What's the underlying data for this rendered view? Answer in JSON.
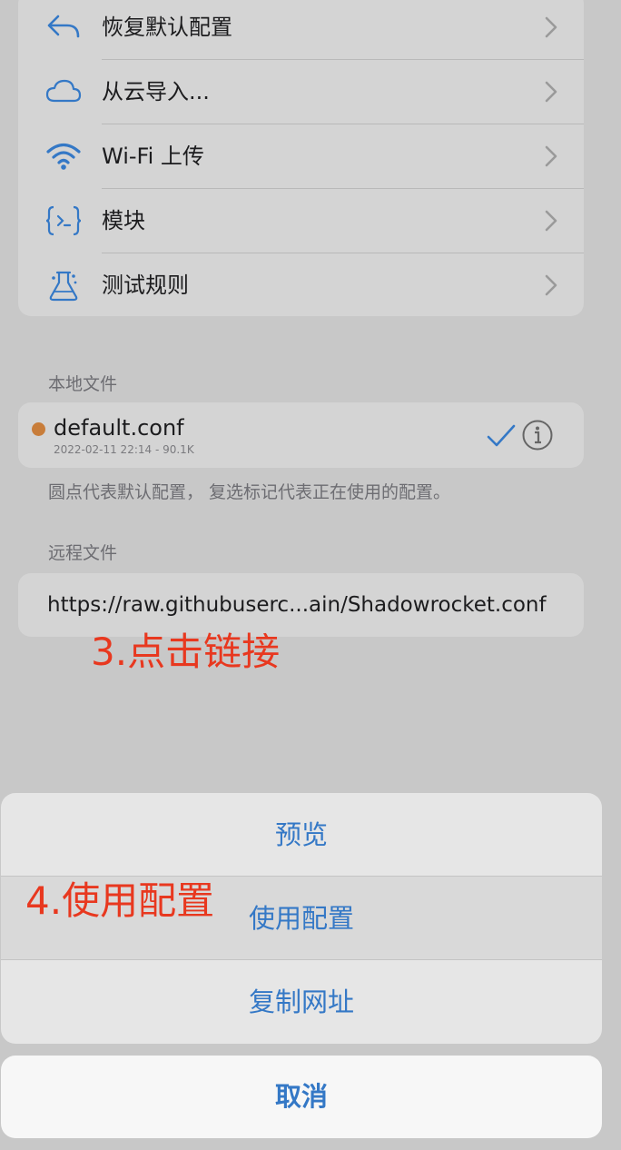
{
  "menu": {
    "items": [
      {
        "label": "恢复默认配置",
        "icon": "undo-arrow-icon"
      },
      {
        "label": "从云导入...",
        "icon": "cloud-icon"
      },
      {
        "label": "Wi-Fi 上传",
        "icon": "wifi-icon"
      },
      {
        "label": "模块",
        "icon": "code-braces-icon"
      },
      {
        "label": "测试规则",
        "icon": "flask-icon"
      }
    ]
  },
  "local": {
    "header": "本地文件",
    "file_name": "default.conf",
    "file_meta": "2022-02-11 22:14 - 90.1K",
    "note": "圆点代表默认配置， 复选标记代表正在使用的配置。",
    "dot_color": "#c87d3a"
  },
  "remote": {
    "header": "远程文件",
    "url": "https://raw.githubuserc...ain/Shadowrocket.conf"
  },
  "annotations": {
    "step3": "3.点击链接",
    "step4": "4.使用配置",
    "color": "#e8381f"
  },
  "sheet": {
    "preview": "预览",
    "use_config": "使用配置",
    "copy_url": "复制网址",
    "cancel": "取消",
    "accent": "#3478c6"
  }
}
